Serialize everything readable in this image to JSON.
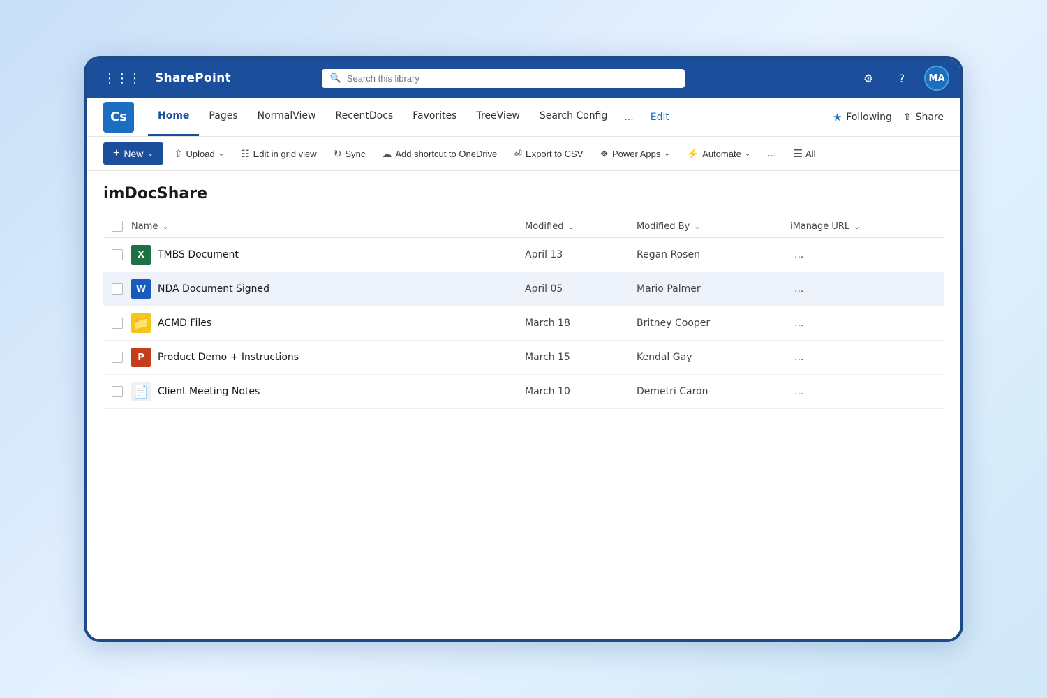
{
  "app": {
    "name": "SharePoint",
    "search_placeholder": "Search this library"
  },
  "user": {
    "initials": "MA"
  },
  "site": {
    "logo_text": "Cs",
    "nav_items": [
      {
        "label": "Home",
        "active": true
      },
      {
        "label": "Pages",
        "active": false
      },
      {
        "label": "NormalView",
        "active": false
      },
      {
        "label": "RecentDocs",
        "active": false
      },
      {
        "label": "Favorites",
        "active": false
      },
      {
        "label": "TreeView",
        "active": false
      },
      {
        "label": "Search Config",
        "active": false
      }
    ],
    "nav_more": "...",
    "nav_edit": "Edit",
    "following_label": "Following",
    "share_label": "Share"
  },
  "toolbar": {
    "new_label": "New",
    "upload_label": "Upload",
    "edit_grid_label": "Edit in grid view",
    "sync_label": "Sync",
    "add_onedrive_label": "Add shortcut to OneDrive",
    "export_csv_label": "Export to CSV",
    "power_apps_label": "Power Apps",
    "automate_label": "Automate",
    "more_label": "...",
    "all_label": "All"
  },
  "library": {
    "title": "imDocShare",
    "columns": {
      "name": "Name",
      "modified": "Modified",
      "modified_by": "Modified By",
      "imanage_url": "iManage URL"
    },
    "files": [
      {
        "type": "excel",
        "name": "TMBS Document",
        "modified": "April 13",
        "modified_by": "Regan Rosen",
        "url": "..."
      },
      {
        "type": "word",
        "name": "NDA Document Signed",
        "modified": "April 05",
        "modified_by": "Mario Palmer",
        "url": "...",
        "selected": true
      },
      {
        "type": "folder",
        "name": "ACMD Files",
        "modified": "March 18",
        "modified_by": "Britney Cooper",
        "url": "..."
      },
      {
        "type": "ppt",
        "name": "Product Demo + Instructions",
        "modified": "March 15",
        "modified_by": "Kendal Gay",
        "url": "..."
      },
      {
        "type": "txt",
        "name": "Client Meeting Notes",
        "modified": "March 10",
        "modified_by": "Demetri Caron",
        "url": "..."
      }
    ]
  }
}
